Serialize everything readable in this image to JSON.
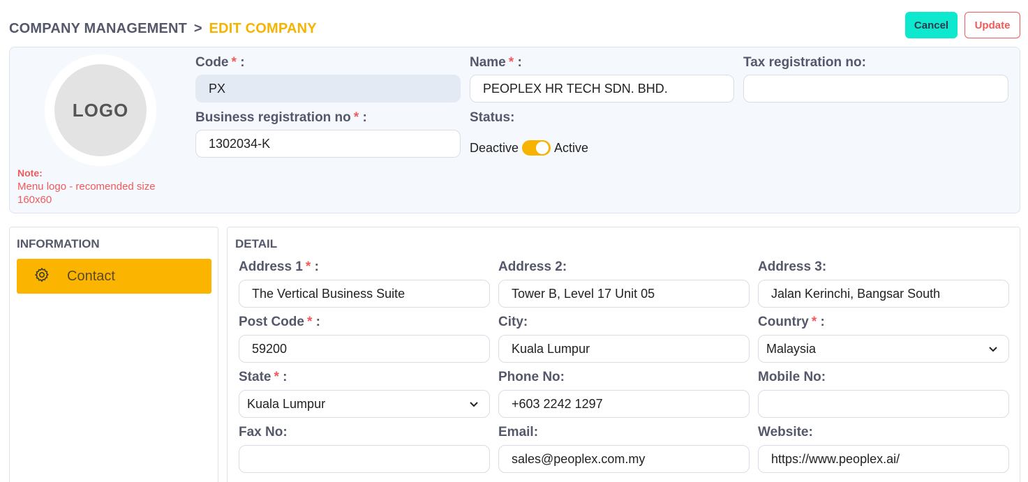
{
  "breadcrumb": {
    "root": "COMPANY MANAGEMENT",
    "separator": ">",
    "current": "EDIT COMPANY"
  },
  "actions": {
    "cancel": "Cancel",
    "update": "Update"
  },
  "logo": {
    "text": "LOGO",
    "note_title": "Note:",
    "note_text": "Menu logo - recomended size 160x60"
  },
  "company": {
    "code_label": "Code",
    "code_value": "PX",
    "name_label": "Name",
    "name_value": "PEOPLEX HR TECH SDN. BHD.",
    "tax_label": "Tax registration no:",
    "tax_value": "",
    "brn_label": "Business registration no",
    "brn_value": "1302034-K",
    "status_label": "Status:",
    "status_off": "Deactive",
    "status_on": "Active",
    "required_mark": "*",
    "colon": ":"
  },
  "sidebar": {
    "title": "INFORMATION",
    "items": [
      {
        "label": "Contact",
        "icon": "gear-icon",
        "active": true
      }
    ]
  },
  "detail": {
    "title": "DETAIL",
    "address1_label": "Address 1",
    "address1_value": "The Vertical Business Suite",
    "address2_label": "Address 2:",
    "address2_value": "Tower B, Level 17 Unit 05",
    "address3_label": "Address 3:",
    "address3_value": "Jalan Kerinchi, Bangsar South",
    "postcode_label": "Post Code",
    "postcode_value": "59200",
    "city_label": "City:",
    "city_value": "Kuala Lumpur",
    "country_label": "Country",
    "country_value": "Malaysia",
    "state_label": "State",
    "state_value": "Kuala Lumpur",
    "phone_label": "Phone No:",
    "phone_value": "+603 2242 1297",
    "mobile_label": "Mobile No:",
    "mobile_value": "",
    "fax_label": "Fax No:",
    "fax_value": "",
    "email_label": "Email:",
    "email_value": "sales@peoplex.com.my",
    "website_label": "Website:",
    "website_value": "https://www.peoplex.ai/"
  },
  "colors": {
    "accent": "#f6b400",
    "primary_button": "#0ee8cf",
    "danger": "#f05a5a",
    "card_bg": "#f5f8fd"
  }
}
